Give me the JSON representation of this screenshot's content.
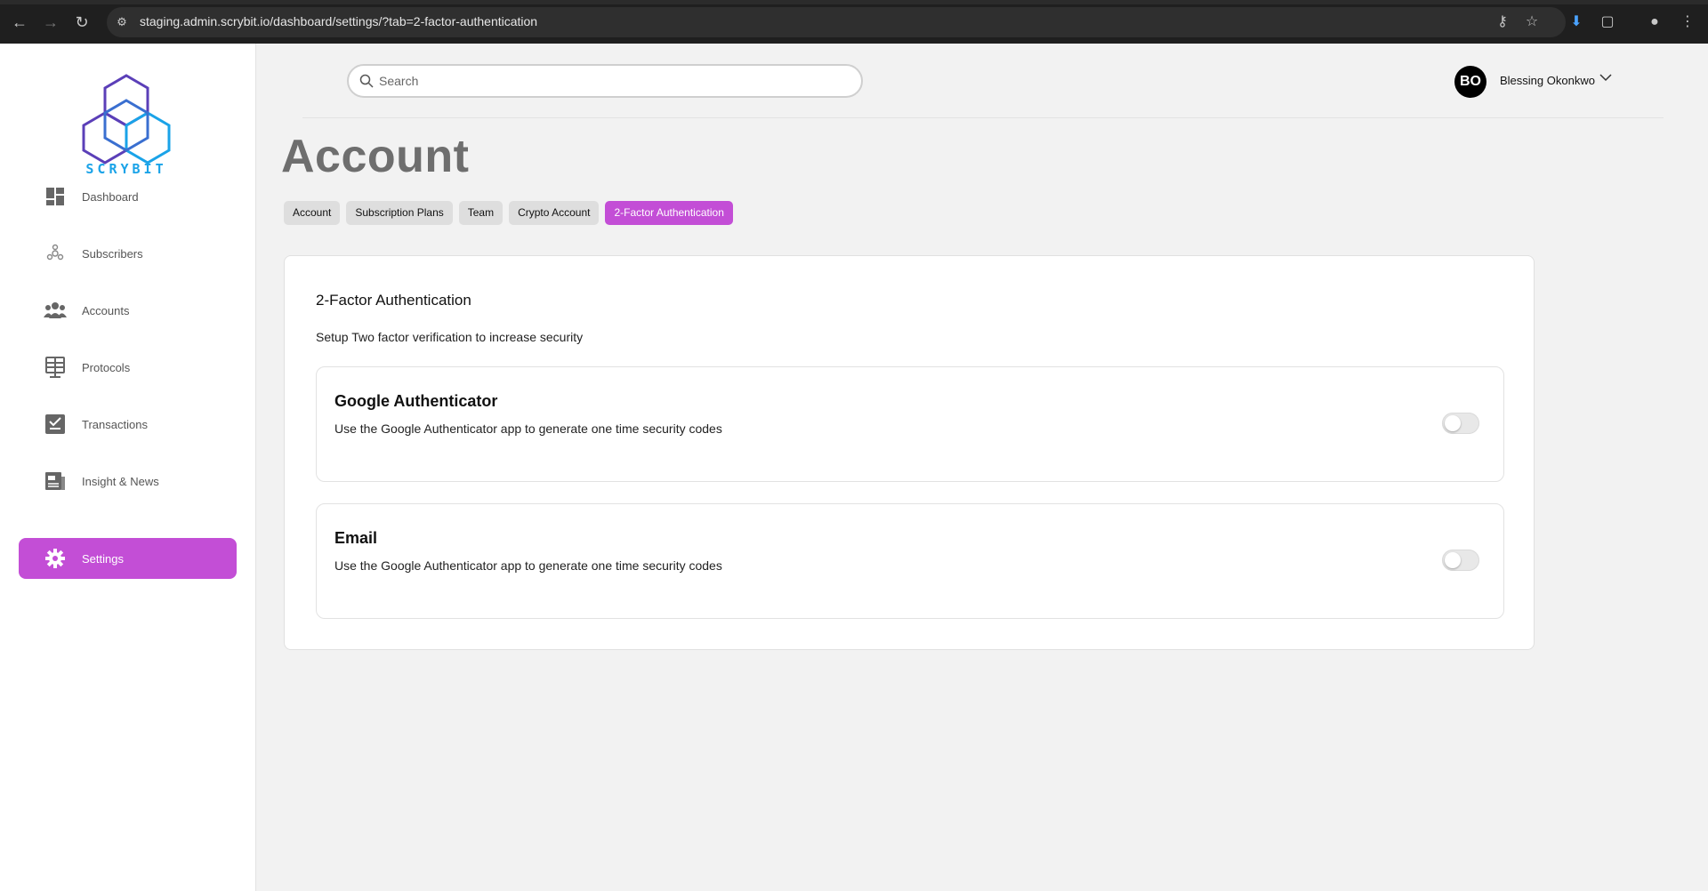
{
  "browser": {
    "url": "staging.admin.scrybit.io/dashboard/settings/?tab=2-factor-authentication"
  },
  "sidebar": {
    "logo_text": "SCRYBIT",
    "items": [
      {
        "label": "Dashboard",
        "icon": "dashboard-icon",
        "active": false
      },
      {
        "label": "Subscribers",
        "icon": "subscribers-icon",
        "active": false
      },
      {
        "label": "Accounts",
        "icon": "accounts-icon",
        "active": false
      },
      {
        "label": "Protocols",
        "icon": "protocols-icon",
        "active": false
      },
      {
        "label": "Transactions",
        "icon": "transactions-icon",
        "active": false
      },
      {
        "label": "Insight & News",
        "icon": "news-icon",
        "active": false
      },
      {
        "label": "Settings",
        "icon": "gear-icon",
        "active": true
      }
    ]
  },
  "header": {
    "search_placeholder": "Search",
    "user_initials": "BO",
    "user_name": "Blessing Okonkwo"
  },
  "page": {
    "title": "Account",
    "tabs": [
      {
        "label": "Account",
        "active": false
      },
      {
        "label": "Subscription Plans",
        "active": false
      },
      {
        "label": "Team",
        "active": false
      },
      {
        "label": "Crypto Account",
        "active": false
      },
      {
        "label": "2-Factor Authentication",
        "active": true
      }
    ]
  },
  "card": {
    "title": "2-Factor Authentication",
    "subtitle": "Setup Two factor verification to increase security",
    "options": [
      {
        "title": "Google Authenticator",
        "description": "Use the Google Authenticator app to generate one time security codes",
        "enabled": false
      },
      {
        "title": "Email",
        "description": "Use the Google Authenticator app to generate one time security codes",
        "enabled": false
      }
    ]
  },
  "colors": {
    "accent": "#c34ed6",
    "logo_blue": "#1aa3e8",
    "logo_purple": "#5b3fb8"
  }
}
